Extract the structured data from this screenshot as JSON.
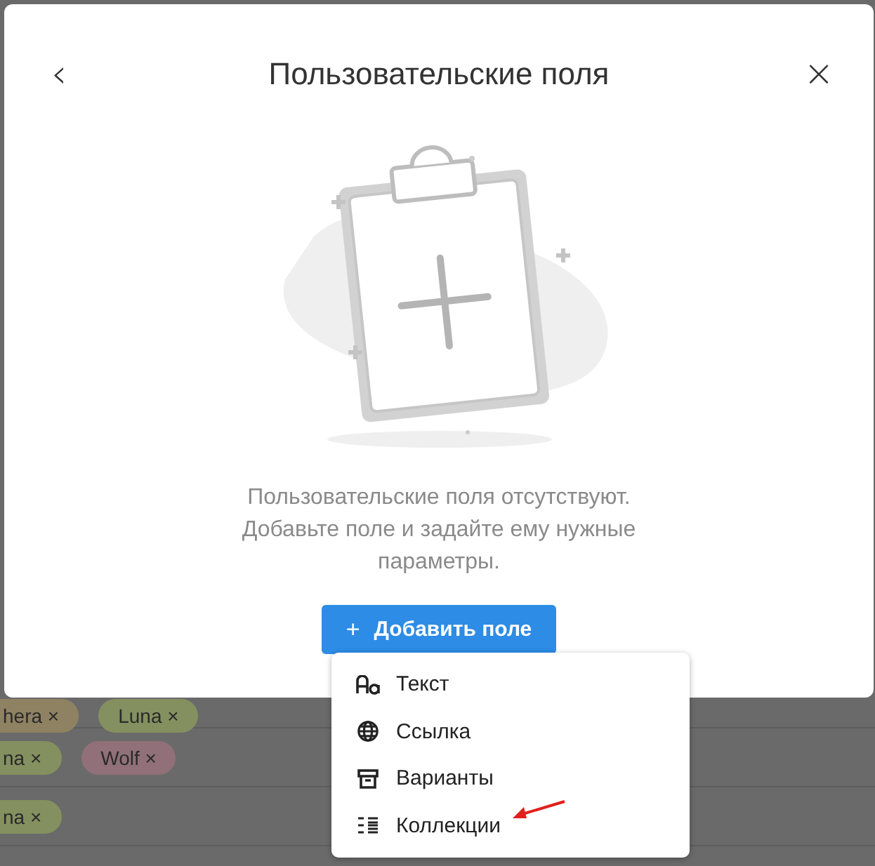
{
  "background_rows": [
    {
      "tags": [
        {
          "label": "hera",
          "remove": "×",
          "color": "#8f8262"
        },
        {
          "label": "Luna",
          "remove": "×",
          "color": "#84905f"
        }
      ]
    },
    {
      "tags": [
        {
          "label": "na",
          "remove": "×",
          "color": "#84905f"
        },
        {
          "label": "Wolf",
          "remove": "×",
          "color": "#917079"
        }
      ]
    },
    {
      "tags": [
        {
          "label": "na",
          "remove": "×",
          "color": "#84905f"
        }
      ]
    }
  ],
  "dialog": {
    "back": "‹",
    "title": "Пользовательские поля",
    "close": "×",
    "empty_text": "Пользовательские поля отсутствуют. Добавьте поле и задайте ему нужные параметры.",
    "add_button": {
      "icon": "+",
      "label": "Добавить поле"
    },
    "menu": [
      {
        "kind": "text",
        "label": "Текст"
      },
      {
        "kind": "link",
        "label": "Ссылка"
      },
      {
        "kind": "options",
        "label": "Варианты"
      },
      {
        "kind": "collection",
        "label": "Коллекции"
      }
    ]
  }
}
